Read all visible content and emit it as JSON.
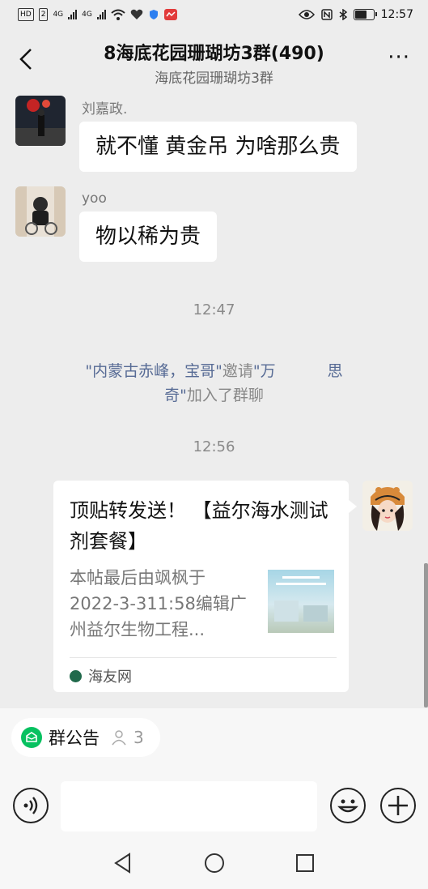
{
  "status_bar": {
    "hd_badge": "HD",
    "sim_badge": "2",
    "net1": "4G",
    "net2": "4G",
    "time": "12:57",
    "battery_level": 0.7
  },
  "header": {
    "title": "8海底花园珊瑚坊3群(490)",
    "subtitle": "海底花园珊瑚坊3群",
    "more_label": "···"
  },
  "messages": [
    {
      "sender": "刘嘉政.",
      "text": "就不懂 黄金吊 为啥那么贵"
    },
    {
      "sender": "yoo",
      "text": "物以稀为贵"
    }
  ],
  "time_separators": [
    "12:47",
    "12:56"
  ],
  "system_message": {
    "link1": "\"内蒙古赤峰，宝哥\"",
    "mid": "邀请",
    "link2a": "\"万",
    "link2b": "思",
    "link2c": "奇\"",
    "tail": "加入了群聊"
  },
  "card_message": {
    "title": "顶贴转发送！ 【益尔海水测试剂套餐】",
    "description": "本帖最后由飒枫于2022-3-311:58编辑广州益尔生物工程...",
    "source": "海友网"
  },
  "bottom": {
    "notice_label": "群公告",
    "notice_icon": "notice-icon",
    "member_count": "3",
    "input_placeholder": ""
  },
  "colors": {
    "background": "#ededed",
    "link": "#576b95",
    "accent_green": "#07c160"
  }
}
